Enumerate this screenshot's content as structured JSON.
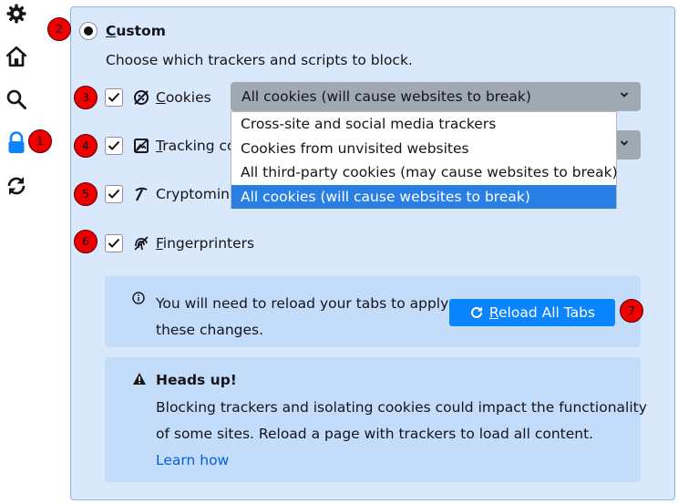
{
  "sidebar": {
    "icons": [
      "gear-icon",
      "home-icon",
      "search-icon",
      "lock-icon",
      "sync-icon"
    ]
  },
  "annotations": [
    "1",
    "2",
    "3",
    "4",
    "5",
    "6",
    "7"
  ],
  "custom": {
    "accesskey_letter": "C",
    "label_rest": "ustom",
    "description": "Choose which trackers and scripts to block."
  },
  "rows": {
    "cookies": {
      "accesskey_letter": "C",
      "rest": "ookies"
    },
    "tracking": {
      "accesskey_letter": "T",
      "rest": "racking co"
    },
    "crypto": {
      "label": "Cryptomine"
    },
    "fingerprint": {
      "accesskey_letter": "F",
      "rest": "ingerprinters"
    }
  },
  "cookie_select": {
    "value": "All cookies (will cause websites to break)",
    "options": [
      "Cross-site and social media trackers",
      "Cookies from unvisited websites",
      "All third-party cookies (may cause websites to break)",
      "All cookies (will cause websites to break)"
    ],
    "selected_index": 3
  },
  "reload_info": {
    "line1": "You will need to reload your tabs to apply",
    "line2": "these changes.",
    "button_accesskey": "R",
    "button_rest": "eload All Tabs"
  },
  "warning": {
    "title": "Heads up!",
    "line1": "Blocking trackers and isolating cookies could impact the functionality",
    "line2": "of some sites. Reload a page with trackers to load all content.",
    "link": "Learn how"
  },
  "colors": {
    "panel_bg": "#d9e8fb",
    "accent": "#0a84ff",
    "badge": "#ee0000"
  }
}
